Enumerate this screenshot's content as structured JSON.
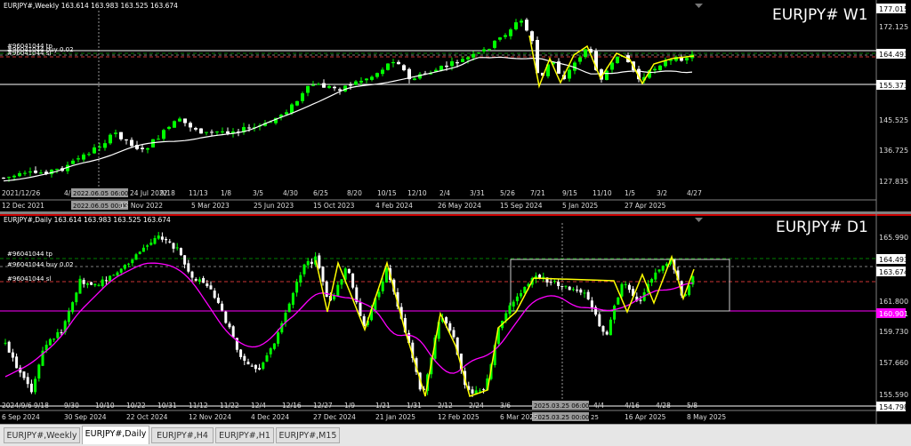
{
  "chart1": {
    "header": "EURJPY#,Weekly  163.614 163.983 163.525 163.674",
    "big_label": "EURJPY# W1",
    "price_labels": [
      "177.015",
      "172.125",
      "164.493",
      "155.373",
      "145.525",
      "136.725",
      "127.835"
    ],
    "order_labels": [
      "#96041044 tp",
      "#96041044 buy 0.02",
      "#96041044 sl"
    ],
    "time_labels": [
      "12 Dec 2021",
      "13 Nov 2022",
      "5 Mar 2023",
      "25 Jun 2023",
      "15 Oct 2023",
      "4 Feb 2024",
      "26 May 2024",
      "15 Sep 2024",
      "5 Jan 2025",
      "27 Apr 2025"
    ],
    "date_markers": [
      "2021/12/26",
      "4/",
      "24 Jul 2022",
      "9/18",
      "11/13",
      "1/8",
      "3/5",
      "4/30",
      "6/25",
      "8/20",
      "10/15",
      "12/10",
      "2/4",
      "3/31",
      "5/26",
      "7/21",
      "9/15",
      "11/10",
      "1/5",
      "3/2",
      "4/27"
    ],
    "cursor_label": "2022.06.05 06:00",
    "cursor_label2": "2022.06.05 00:00"
  },
  "chart2": {
    "header": "EURJPY#,Daily  163.614 163.983 163.525 163.674",
    "big_label": "EURJPY# D1",
    "price_labels": [
      "165.990",
      "164.493",
      "163.674",
      "161.800",
      "160.901",
      "159.730",
      "157.660",
      "155.590",
      "154.798"
    ],
    "order_labels": [
      "#96041044 tp",
      "#96041044 buy 0.02",
      "#96041044 sl"
    ],
    "time_labels": [
      "6 Sep 2024",
      "30 Sep 2024",
      "22 Oct 2024",
      "12 Nov 2024",
      "4 Dec 2024",
      "27 Dec 2024",
      "21 Jan 2025",
      "12 Feb 2025",
      "6 Mar 2025",
      "16 Apr 2025",
      "8 May 2025"
    ],
    "date_markers": [
      "2024/9/6",
      "9/18",
      "9/30",
      "10/10",
      "10/22",
      "10/31",
      "11/12",
      "11/22",
      "12/4",
      "12/16",
      "12/27",
      "1/9",
      "1/21",
      "1/31",
      "2/12",
      "2/24",
      "3/6",
      "4/4",
      "4/16",
      "4/28",
      "5/8"
    ],
    "cursor_label": "2025.03.25 06:00",
    "cursor_label2": "2025.03.25 00:00",
    "cursor_tick": "25"
  },
  "tabs": [
    "EURJPY#,Weekly",
    "EURJPY#,Daily",
    "EURJPY#,H4",
    "EURJPY#,H1",
    "EURJPY#,M15"
  ],
  "active_tab": 1,
  "colors": {
    "up": "#00ff00",
    "down": "#ffffff",
    "ma_w1": "#ffffff",
    "ma_d1": "#ff00ff",
    "zigzag": "#ffff00"
  }
}
